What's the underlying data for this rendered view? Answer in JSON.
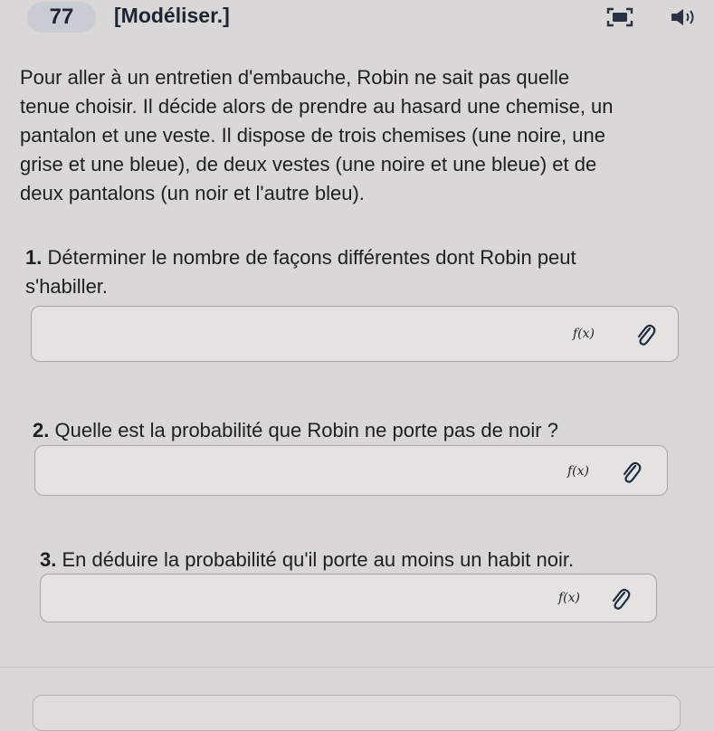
{
  "header": {
    "exercise_number": "77",
    "exercise_tag": "[Modéliser.]",
    "icons": [
      "fullscreen-icon",
      "speaker-icon"
    ]
  },
  "statement": {
    "lines": [
      "Pour aller à un entretien d'embauche, Robin ne sait pas quelle",
      "tenue choisir. Il décide alors de prendre au hasard une chemise, un",
      "pantalon et une veste. Il dispose de trois chemises (une noire, une",
      "grise et une bleue), de deux vestes (une noire et une bleue) et de",
      "deux pantalons (un noir et l'autre bleu)."
    ]
  },
  "questions": [
    {
      "number": "1.",
      "lines": [
        "Déterminer le nombre de façons différentes dont Robin peut",
        "s'habiller."
      ],
      "answer": "",
      "fx_label": "f(x)"
    },
    {
      "number": "2.",
      "lines": [
        "Quelle est la probabilité que Robin ne porte pas de noir ?"
      ],
      "answer": "",
      "fx_label": "f(x)"
    },
    {
      "number": "3.",
      "lines": [
        "En déduire la probabilité qu'il porte au moins un habit noir."
      ],
      "answer": "",
      "fx_label": "f(x)"
    }
  ],
  "colors": {
    "background": "#d9d8d6",
    "badge": "#c9cdd3",
    "answer_box": "#e4e3e1",
    "text": "#1f1f22"
  }
}
